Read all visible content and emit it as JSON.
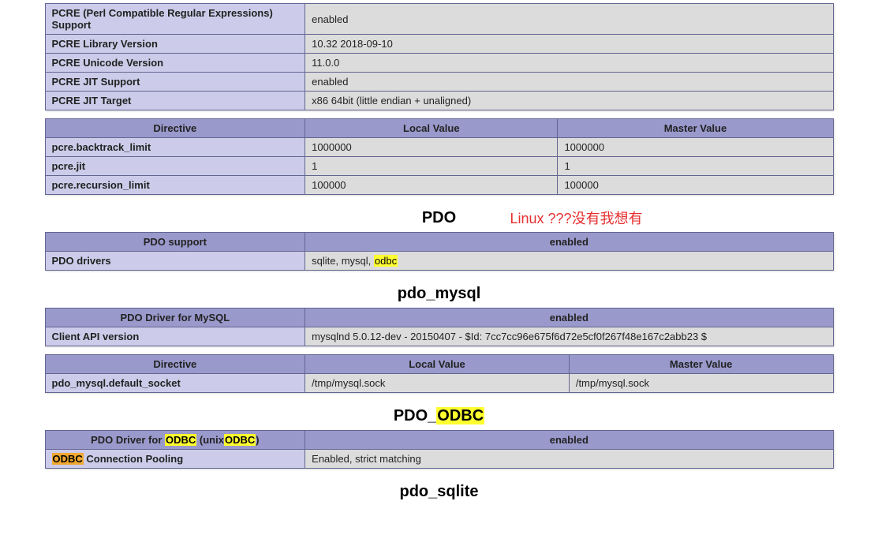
{
  "pcre_info": {
    "rows": [
      {
        "label": "PCRE (Perl Compatible Regular Expressions) Support",
        "value": "enabled"
      },
      {
        "label": "PCRE Library Version",
        "value": "10.32 2018-09-10"
      },
      {
        "label": "PCRE Unicode Version",
        "value": "11.0.0"
      },
      {
        "label": "PCRE JIT Support",
        "value": "enabled"
      },
      {
        "label": "PCRE JIT Target",
        "value": "x86 64bit (little endian + unaligned)"
      }
    ]
  },
  "pcre_directives": {
    "headers": {
      "directive": "Directive",
      "local": "Local Value",
      "master": "Master Value"
    },
    "rows": [
      {
        "directive": "pcre.backtrack_limit",
        "local": "1000000",
        "master": "1000000"
      },
      {
        "directive": "pcre.jit",
        "local": "1",
        "master": "1"
      },
      {
        "directive": "pcre.recursion_limit",
        "local": "100000",
        "master": "100000"
      }
    ]
  },
  "section_pdo": {
    "title": "PDO",
    "annotation": "Linux ???没有我想有",
    "headers": {
      "left": "PDO support",
      "right": "enabled"
    },
    "drivers_label": "PDO drivers",
    "drivers_prefix": "sqlite, mysql, ",
    "drivers_highlight": "odbc"
  },
  "section_pdo_mysql": {
    "title": "pdo_mysql",
    "headers": {
      "left": "PDO Driver for MySQL",
      "right": "enabled"
    },
    "client_api_label": "Client API version",
    "client_api_value": "mysqlnd 5.0.12-dev - 20150407 - $Id: 7cc7cc96e675f6d72e5cf0f267f48e167c2abb23 $",
    "dir_headers": {
      "directive": "Directive",
      "local": "Local Value",
      "master": "Master Value"
    },
    "dir_rows": [
      {
        "directive": "pdo_mysql.default_socket",
        "local": "/tmp/mysql.sock",
        "master": "/tmp/mysql.sock"
      }
    ]
  },
  "section_pdo_odbc": {
    "title_prefix": "PDO_",
    "title_highlight": "ODBC",
    "header_left_prefix": "PDO Driver for ",
    "header_left_hl1": "ODBC",
    "header_left_mid": " (unix",
    "header_left_hl2": "ODBC",
    "header_left_suffix": ")",
    "header_right": "enabled",
    "row_label_hl": "ODBC",
    "row_label_rest": " Connection Pooling",
    "row_value": "Enabled, strict matching"
  },
  "section_pdo_sqlite": {
    "title": "pdo_sqlite"
  }
}
